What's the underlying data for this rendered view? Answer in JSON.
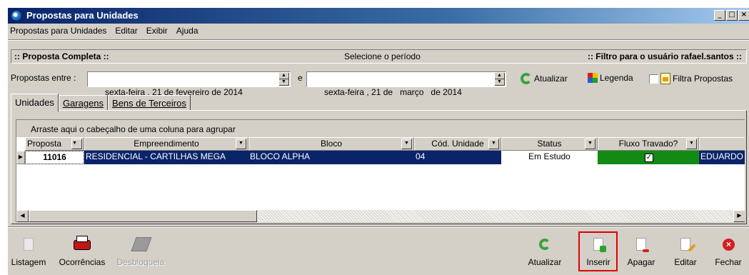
{
  "window": {
    "title": "Propostas para Unidades",
    "controls": [
      "_",
      "□",
      "×"
    ]
  },
  "menu": [
    "Propostas para Unidades",
    "Editar",
    "Exibir",
    "Ajuda"
  ],
  "header": {
    "left": ":: Proposta Completa ::",
    "center": "Selecione o período",
    "right": ":: Filtro para o usuário rafael.santos ::"
  },
  "period": {
    "label": "Propostas entre :",
    "start": "sexta-feira , 21 de fevereiro de 2014",
    "joiner": "e",
    "end": "sexta-feira , 21 de   março   de 2014"
  },
  "toolbar": {
    "refresh": "Atualizar",
    "legend": "Legenda",
    "filter": "Filtra Propostas"
  },
  "tabs": [
    "Unidades",
    "Garagens",
    "Bens de Terceiros"
  ],
  "grid": {
    "group_hint": "Arraste aqui o cabeçalho de uma coluna para agrupar",
    "columns": [
      "Proposta",
      "Empreendimento",
      "Bloco",
      "Cód. Unidade",
      "Status",
      "Fluxo Travado?",
      ""
    ],
    "rows": [
      {
        "proposta": "11016",
        "empreendimento": "RESIDENCIAL - CARTILHAS MEGA",
        "bloco": "BLOCO ALPHA",
        "unidade": "04",
        "status": "Em Estudo",
        "fluxo_travado": true,
        "extra": "EDUARDO"
      }
    ]
  },
  "bottom": {
    "listagem": "Listagem",
    "ocorrencias": "Ocorrências",
    "desbloqueia": "Desbloqueia",
    "atualizar": "Atualizar",
    "inserir": "Inserir",
    "apagar": "Apagar",
    "editar": "Editar",
    "fechar": "Fechar"
  },
  "colors": {
    "title_bar": "#0a246a",
    "selection": "#0a246a",
    "fluxo_cell": "#138a13",
    "highlight": "#e00000"
  }
}
